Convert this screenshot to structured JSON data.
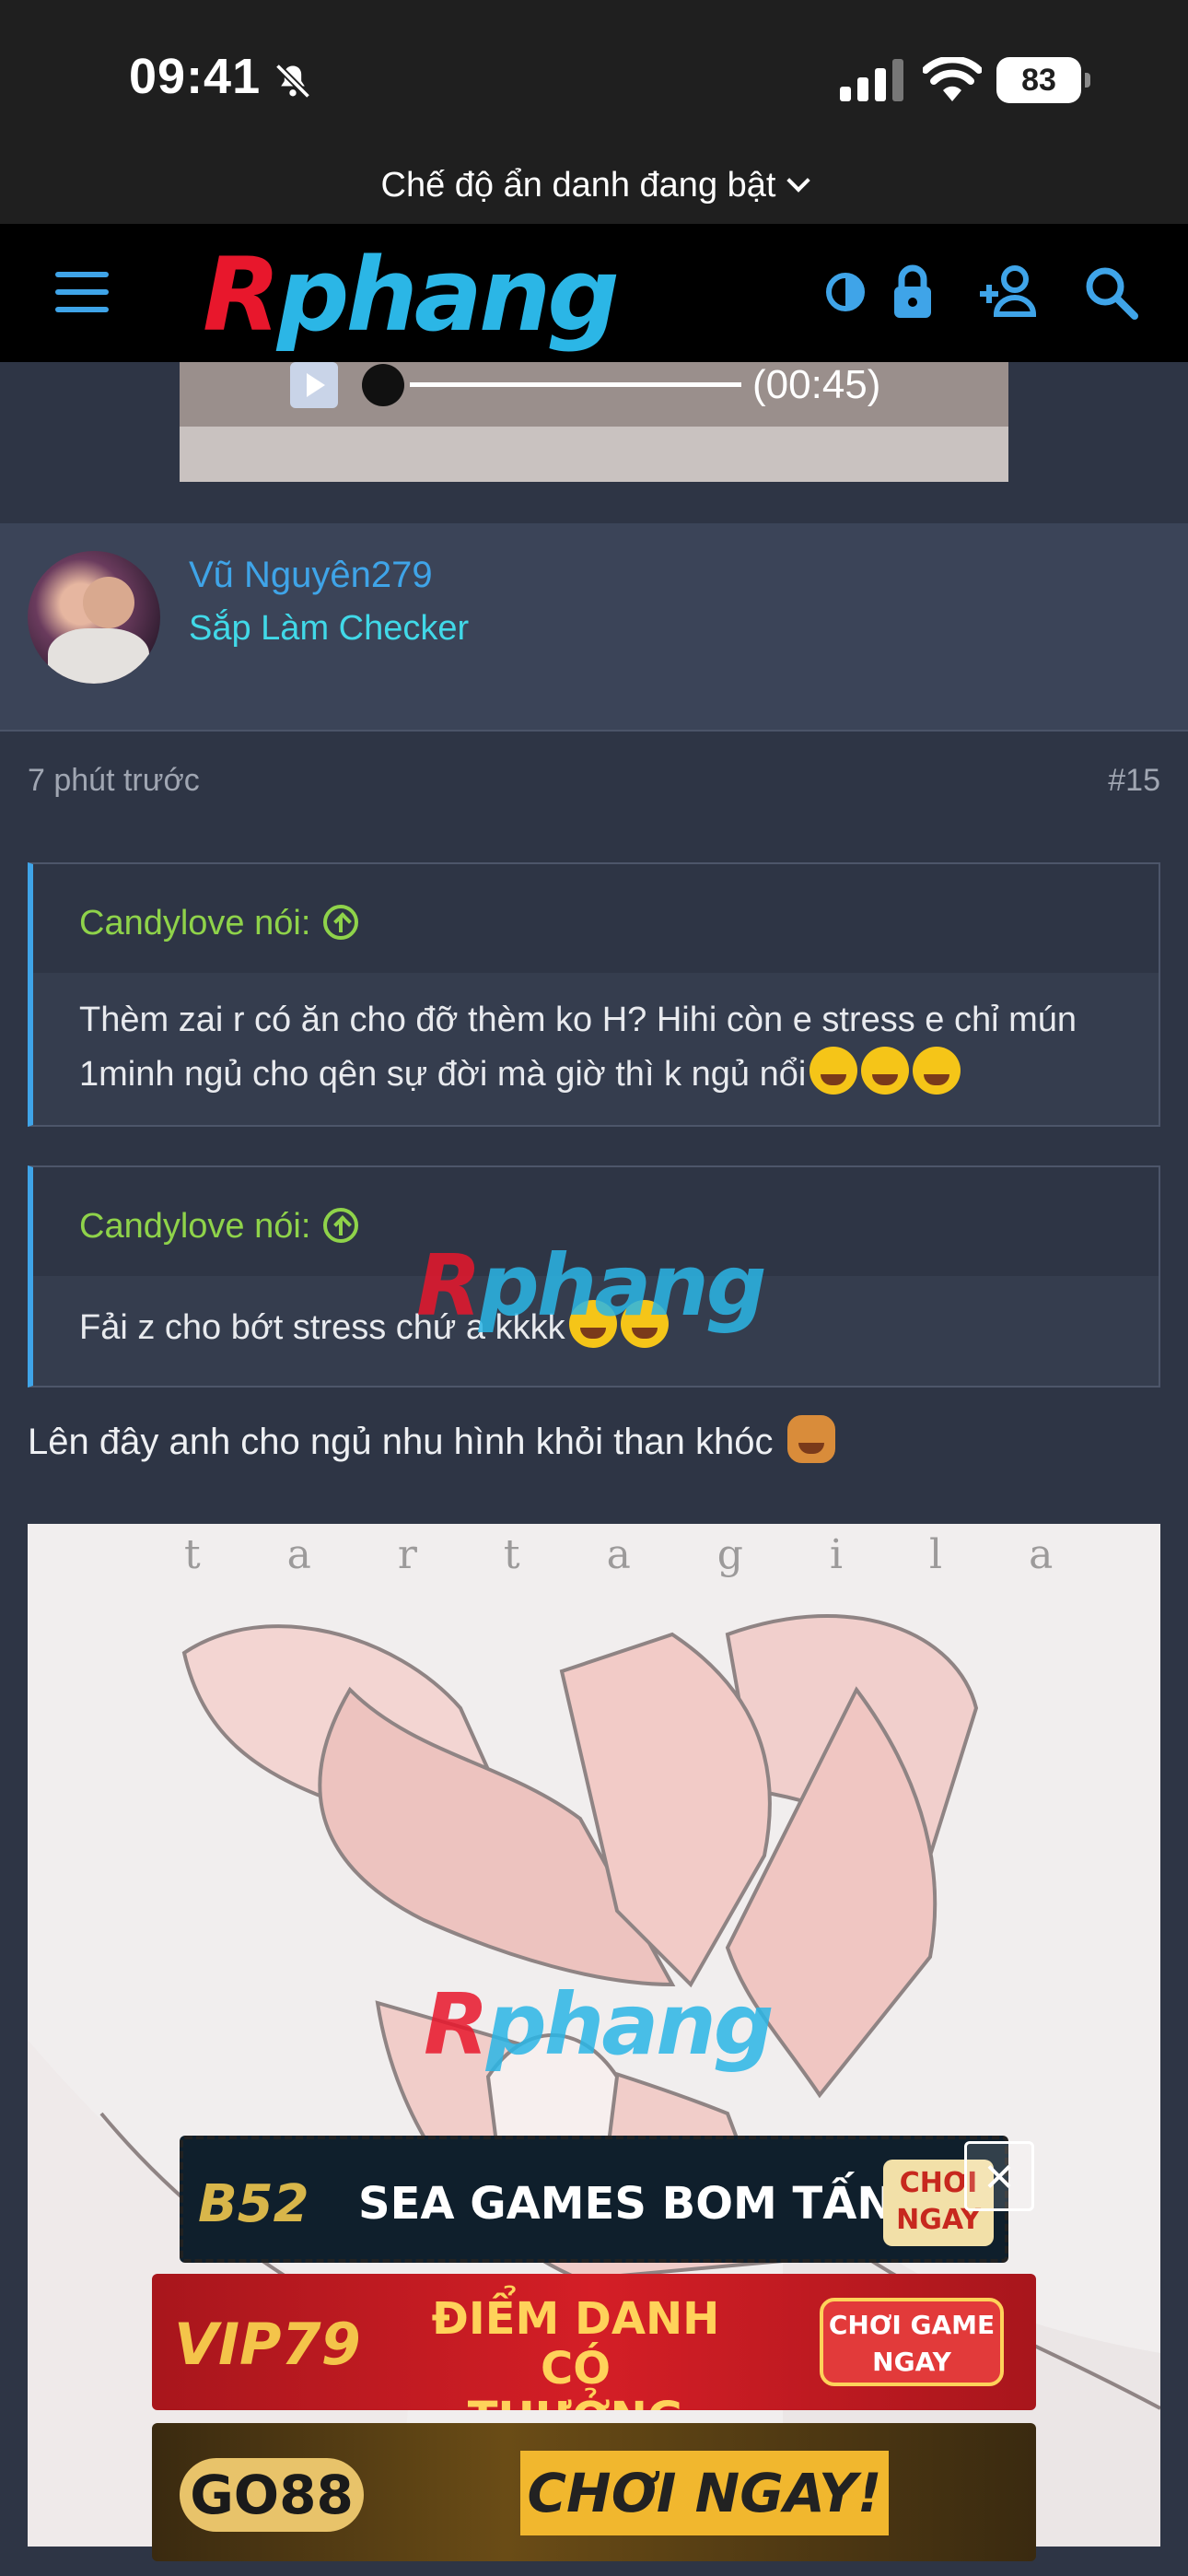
{
  "status_bar": {
    "time": "09:41",
    "battery": "83"
  },
  "browser": {
    "incognito_label": "Chế độ ẩn danh đang bật"
  },
  "header": {
    "logo_first": "R",
    "logo_rest": "phang"
  },
  "media": {
    "duration": "(00:45)"
  },
  "post": {
    "username": "Vũ Nguyên279",
    "user_title": "Sắp Làm Checker",
    "time": "7 phút trước",
    "number": "#15",
    "quotes": [
      {
        "author": "Candylove nói:",
        "text": "Thèm zai r có ăn cho đỡ thèm ko H? Hihi còn e stress e chỉ mún 1minh ngủ cho qên sự đời mà giờ thì k ngủ nổi"
      },
      {
        "author": "Candylove nói:",
        "text": "Fải z cho bớt stress chứ a kkkk"
      }
    ],
    "reply": "Lên đây anh cho ngủ nhu hình khỏi than khóc"
  },
  "ads": [
    {
      "brand": "B52",
      "text": "SEA GAMES BOM TẤN",
      "cta": "CHƠI NGAY"
    },
    {
      "brand": "VIP79",
      "text": "ĐIỂM DANH CÓ THƯỞNG",
      "cta": "CHƠI GAME NGAY"
    },
    {
      "brand": "GO88",
      "text": "CHƠI NGAY!"
    }
  ],
  "image_text": "t a r t a g i l a"
}
